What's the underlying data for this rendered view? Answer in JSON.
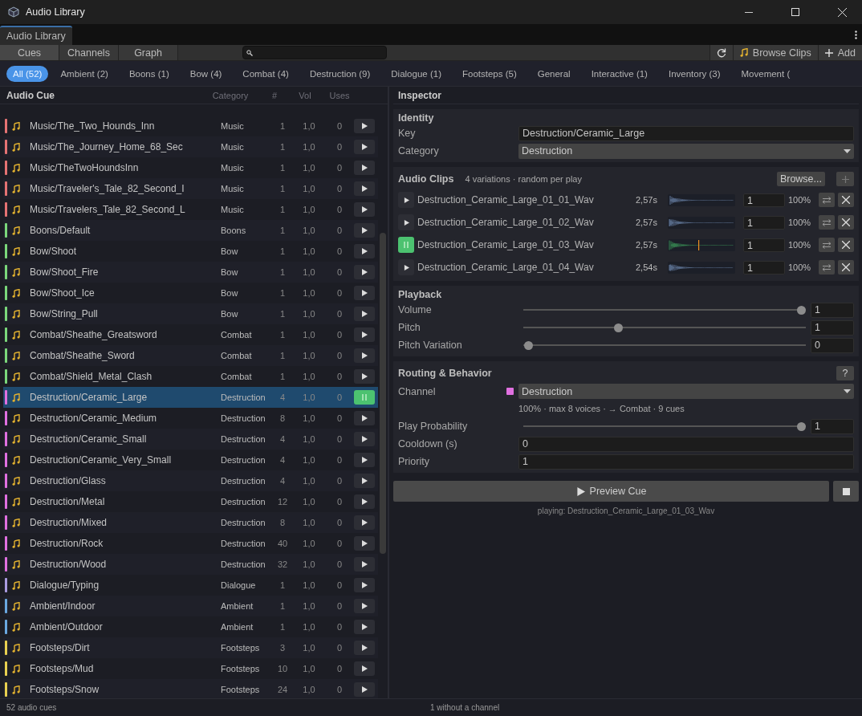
{
  "window": {
    "title": "Audio Library"
  },
  "dock_tabs": [
    {
      "label": "Audio Library",
      "selected": true
    }
  ],
  "view_tabs": [
    {
      "label": "Cues",
      "selected": true
    },
    {
      "label": "Channels",
      "selected": false
    },
    {
      "label": "Graph",
      "selected": false
    }
  ],
  "toolbar": {
    "browse_clips": "Browse Clips",
    "add": "Add"
  },
  "filters": [
    {
      "label": "All (52)",
      "selected": true
    },
    {
      "label": "Ambient (2)",
      "selected": false
    },
    {
      "label": "Boons (1)",
      "selected": false
    },
    {
      "label": "Bow (4)",
      "selected": false
    },
    {
      "label": "Combat (4)",
      "selected": false
    },
    {
      "label": "Destruction (9)",
      "selected": false
    },
    {
      "label": "Dialogue (1)",
      "selected": false
    },
    {
      "label": "Footsteps (5)",
      "selected": false
    },
    {
      "label": "General",
      "selected": false
    },
    {
      "label": "Interactive (1)",
      "selected": false
    },
    {
      "label": "Inventory (3)",
      "selected": false
    },
    {
      "label": "Movement (",
      "selected": false
    }
  ],
  "cue_list": {
    "columns": [
      "Audio Cue",
      "Category",
      "#",
      "Vol",
      "Uses"
    ],
    "rows": [
      {
        "name": "Music/The_Two_Hounds_Inn",
        "category": "Music",
        "count": "1",
        "vol": "1,0",
        "uses": "0",
        "color": "#e57373",
        "selected": false,
        "playing": false
      },
      {
        "name": "Music/The_Journey_Home_68_Sec",
        "category": "Music",
        "count": "1",
        "vol": "1,0",
        "uses": "0",
        "color": "#e57373",
        "selected": false,
        "playing": false
      },
      {
        "name": "Music/TheTwoHoundsInn",
        "category": "Music",
        "count": "1",
        "vol": "1,0",
        "uses": "0",
        "color": "#e57373",
        "selected": false,
        "playing": false
      },
      {
        "name": "Music/Traveler's_Tale_82_Second_I",
        "category": "Music",
        "count": "1",
        "vol": "1,0",
        "uses": "0",
        "color": "#e57373",
        "selected": false,
        "playing": false
      },
      {
        "name": "Music/Travelers_Tale_82_Second_L",
        "category": "Music",
        "count": "1",
        "vol": "1,0",
        "uses": "0",
        "color": "#e57373",
        "selected": false,
        "playing": false
      },
      {
        "name": "Boons/Default",
        "category": "Boons",
        "count": "1",
        "vol": "1,0",
        "uses": "0",
        "color": "#7bd87b",
        "selected": false,
        "playing": false
      },
      {
        "name": "Bow/Shoot",
        "category": "Bow",
        "count": "1",
        "vol": "1,0",
        "uses": "0",
        "color": "#7bd87b",
        "selected": false,
        "playing": false
      },
      {
        "name": "Bow/Shoot_Fire",
        "category": "Bow",
        "count": "1",
        "vol": "1,0",
        "uses": "0",
        "color": "#7bd87b",
        "selected": false,
        "playing": false
      },
      {
        "name": "Bow/Shoot_Ice",
        "category": "Bow",
        "count": "1",
        "vol": "1,0",
        "uses": "0",
        "color": "#7bd87b",
        "selected": false,
        "playing": false
      },
      {
        "name": "Bow/String_Pull",
        "category": "Bow",
        "count": "1",
        "vol": "1,0",
        "uses": "0",
        "color": "#7bd87b",
        "selected": false,
        "playing": false
      },
      {
        "name": "Combat/Sheathe_Greatsword",
        "category": "Combat",
        "count": "1",
        "vol": "1,0",
        "uses": "0",
        "color": "#7bd87b",
        "selected": false,
        "playing": false
      },
      {
        "name": "Combat/Sheathe_Sword",
        "category": "Combat",
        "count": "1",
        "vol": "1,0",
        "uses": "0",
        "color": "#7bd87b",
        "selected": false,
        "playing": false
      },
      {
        "name": "Combat/Shield_Metal_Clash",
        "category": "Combat",
        "count": "1",
        "vol": "1,0",
        "uses": "0",
        "color": "#7bd87b",
        "selected": false,
        "playing": false
      },
      {
        "name": "Destruction/Ceramic_Large",
        "category": "Destruction",
        "count": "4",
        "vol": "1,0",
        "uses": "0",
        "color": "#e070e0",
        "selected": true,
        "playing": true
      },
      {
        "name": "Destruction/Ceramic_Medium",
        "category": "Destruction",
        "count": "8",
        "vol": "1,0",
        "uses": "0",
        "color": "#e070e0",
        "selected": false,
        "playing": false
      },
      {
        "name": "Destruction/Ceramic_Small",
        "category": "Destruction",
        "count": "4",
        "vol": "1,0",
        "uses": "0",
        "color": "#e070e0",
        "selected": false,
        "playing": false
      },
      {
        "name": "Destruction/Ceramic_Very_Small",
        "category": "Destruction",
        "count": "4",
        "vol": "1,0",
        "uses": "0",
        "color": "#e070e0",
        "selected": false,
        "playing": false
      },
      {
        "name": "Destruction/Glass",
        "category": "Destruction",
        "count": "4",
        "vol": "1,0",
        "uses": "0",
        "color": "#e070e0",
        "selected": false,
        "playing": false
      },
      {
        "name": "Destruction/Metal",
        "category": "Destruction",
        "count": "12",
        "vol": "1,0",
        "uses": "0",
        "color": "#e070e0",
        "selected": false,
        "playing": false
      },
      {
        "name": "Destruction/Mixed",
        "category": "Destruction",
        "count": "8",
        "vol": "1,0",
        "uses": "0",
        "color": "#e070e0",
        "selected": false,
        "playing": false
      },
      {
        "name": "Destruction/Rock",
        "category": "Destruction",
        "count": "40",
        "vol": "1,0",
        "uses": "0",
        "color": "#e070e0",
        "selected": false,
        "playing": false
      },
      {
        "name": "Destruction/Wood",
        "category": "Destruction",
        "count": "32",
        "vol": "1,0",
        "uses": "0",
        "color": "#e070e0",
        "selected": false,
        "playing": false
      },
      {
        "name": "Dialogue/Typing",
        "category": "Dialogue",
        "count": "1",
        "vol": "1,0",
        "uses": "0",
        "color": "#a99be0",
        "selected": false,
        "playing": false
      },
      {
        "name": "Ambient/Indoor",
        "category": "Ambient",
        "count": "1",
        "vol": "1,0",
        "uses": "0",
        "color": "#6aa8e0",
        "selected": false,
        "playing": false
      },
      {
        "name": "Ambient/Outdoor",
        "category": "Ambient",
        "count": "1",
        "vol": "1,0",
        "uses": "0",
        "color": "#6aa8e0",
        "selected": false,
        "playing": false
      },
      {
        "name": "Footsteps/Dirt",
        "category": "Footsteps",
        "count": "3",
        "vol": "1,0",
        "uses": "0",
        "color": "#e8d050",
        "selected": false,
        "playing": false
      },
      {
        "name": "Footsteps/Mud",
        "category": "Footsteps",
        "count": "10",
        "vol": "1,0",
        "uses": "0",
        "color": "#e8d050",
        "selected": false,
        "playing": false
      },
      {
        "name": "Footsteps/Snow",
        "category": "Footsteps",
        "count": "24",
        "vol": "1,0",
        "uses": "0",
        "color": "#e8d050",
        "selected": false,
        "playing": false
      }
    ]
  },
  "inspector": {
    "title": "Inspector",
    "identity": {
      "title": "Identity",
      "key_label": "Key",
      "key_value": "Destruction/Ceramic_Large",
      "category_label": "Category",
      "category_value": "Destruction"
    },
    "clips": {
      "title": "Audio Clips",
      "summary": "4 variations · random per play",
      "browse": "Browse...",
      "items": [
        {
          "name": "Destruction_Ceramic_Large_01_01_Wav",
          "duration": "2,57s",
          "weight": "1",
          "percent": "100%",
          "playing": false
        },
        {
          "name": "Destruction_Ceramic_Large_01_02_Wav",
          "duration": "2,57s",
          "weight": "1",
          "percent": "100%",
          "playing": false
        },
        {
          "name": "Destruction_Ceramic_Large_01_03_Wav",
          "duration": "2,57s",
          "weight": "1",
          "percent": "100%",
          "playing": true
        },
        {
          "name": "Destruction_Ceramic_Large_01_04_Wav",
          "duration": "2,54s",
          "weight": "1",
          "percent": "100%",
          "playing": false
        }
      ]
    },
    "playback": {
      "title": "Playback",
      "sliders": [
        {
          "label": "Volume",
          "level": 1,
          "value": "1"
        },
        {
          "label": "Pitch",
          "level": 0.33,
          "value": "1"
        },
        {
          "label": "Pitch Variation",
          "level": 0,
          "value": "0"
        }
      ]
    },
    "routing": {
      "title": "Routing & Behavior",
      "help": "?",
      "channel": {
        "label": "Channel",
        "value": "Destruction",
        "color": "#e070e0",
        "info": "100% · max 8 voices · → Combat · 9 cues"
      },
      "probability": {
        "label": "Play Probability",
        "level": 1,
        "value": "1"
      },
      "cooldown_label": "Cooldown (s)",
      "cooldown_value": "0",
      "priority_label": "Priority",
      "priority_value": "1"
    },
    "preview": {
      "label": "Preview Cue",
      "status": "playing: Destruction_Ceramic_Large_01_03_Wav"
    }
  },
  "status_bar": {
    "left": "52 audio cues",
    "center": "1 without a channel"
  }
}
